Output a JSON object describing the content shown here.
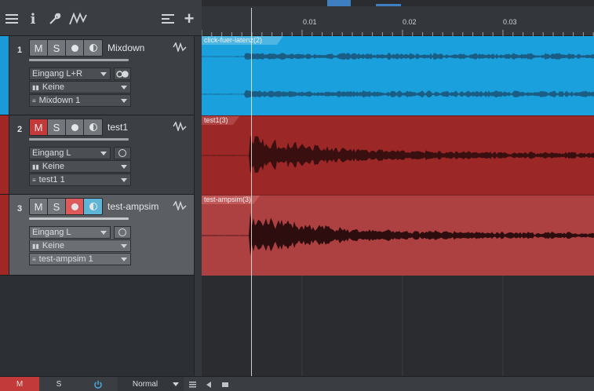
{
  "toolbar": {
    "icons": [
      "list-icon",
      "info-icon",
      "wrench-icon",
      "automation-icon",
      "track-list-icon",
      "add-track-icon"
    ],
    "info_glyph": "i",
    "add_glyph": "+"
  },
  "tracks": [
    {
      "number": "1",
      "name": "Mixdown",
      "color": "#1a9ad6",
      "buttons": {
        "mute": "M",
        "solo": "S"
      },
      "mute_on": false,
      "rec_on": false,
      "monitor_on": false,
      "input": "Eingang L+R",
      "output": "Keine",
      "channel": "Mixdown 1",
      "selected": false,
      "clip": {
        "label": "click-fuer-latenz(2)",
        "color": "#1aa0dc",
        "wave": "#1f5d82"
      }
    },
    {
      "number": "2",
      "name": "test1",
      "color": "#a12626",
      "buttons": {
        "mute": "M",
        "solo": "S"
      },
      "mute_on": true,
      "rec_on": false,
      "monitor_on": false,
      "input": "Eingang L",
      "output": "Keine",
      "channel": "test1 1",
      "selected": false,
      "clip": {
        "label": "test1(3)",
        "color": "#9c2727",
        "wave": "#3a0f10"
      }
    },
    {
      "number": "3",
      "name": "test-ampsim",
      "color": "#a12626",
      "buttons": {
        "mute": "M",
        "solo": "S"
      },
      "mute_on": false,
      "rec_on": true,
      "monitor_on": true,
      "input": "Eingang L",
      "output": "Keine",
      "channel": "test-ampsim 1",
      "selected": true,
      "clip": {
        "label": "test-ampsim(3)",
        "color": "#ad4040",
        "wave": "#2e0d0f"
      }
    }
  ],
  "ruler": {
    "ticks": [
      "0.01",
      "0.02",
      "0.03"
    ]
  },
  "bottom_bar": {
    "mute_label": "M",
    "solo_label": "S",
    "power_icon": "power-icon",
    "mode_label": "Normal"
  },
  "colors": {
    "accent_blue": "#1a9ad6",
    "track_red": "#a12626",
    "mute_red": "#c23a3a",
    "monitor_blue": "#5fb5d6"
  }
}
